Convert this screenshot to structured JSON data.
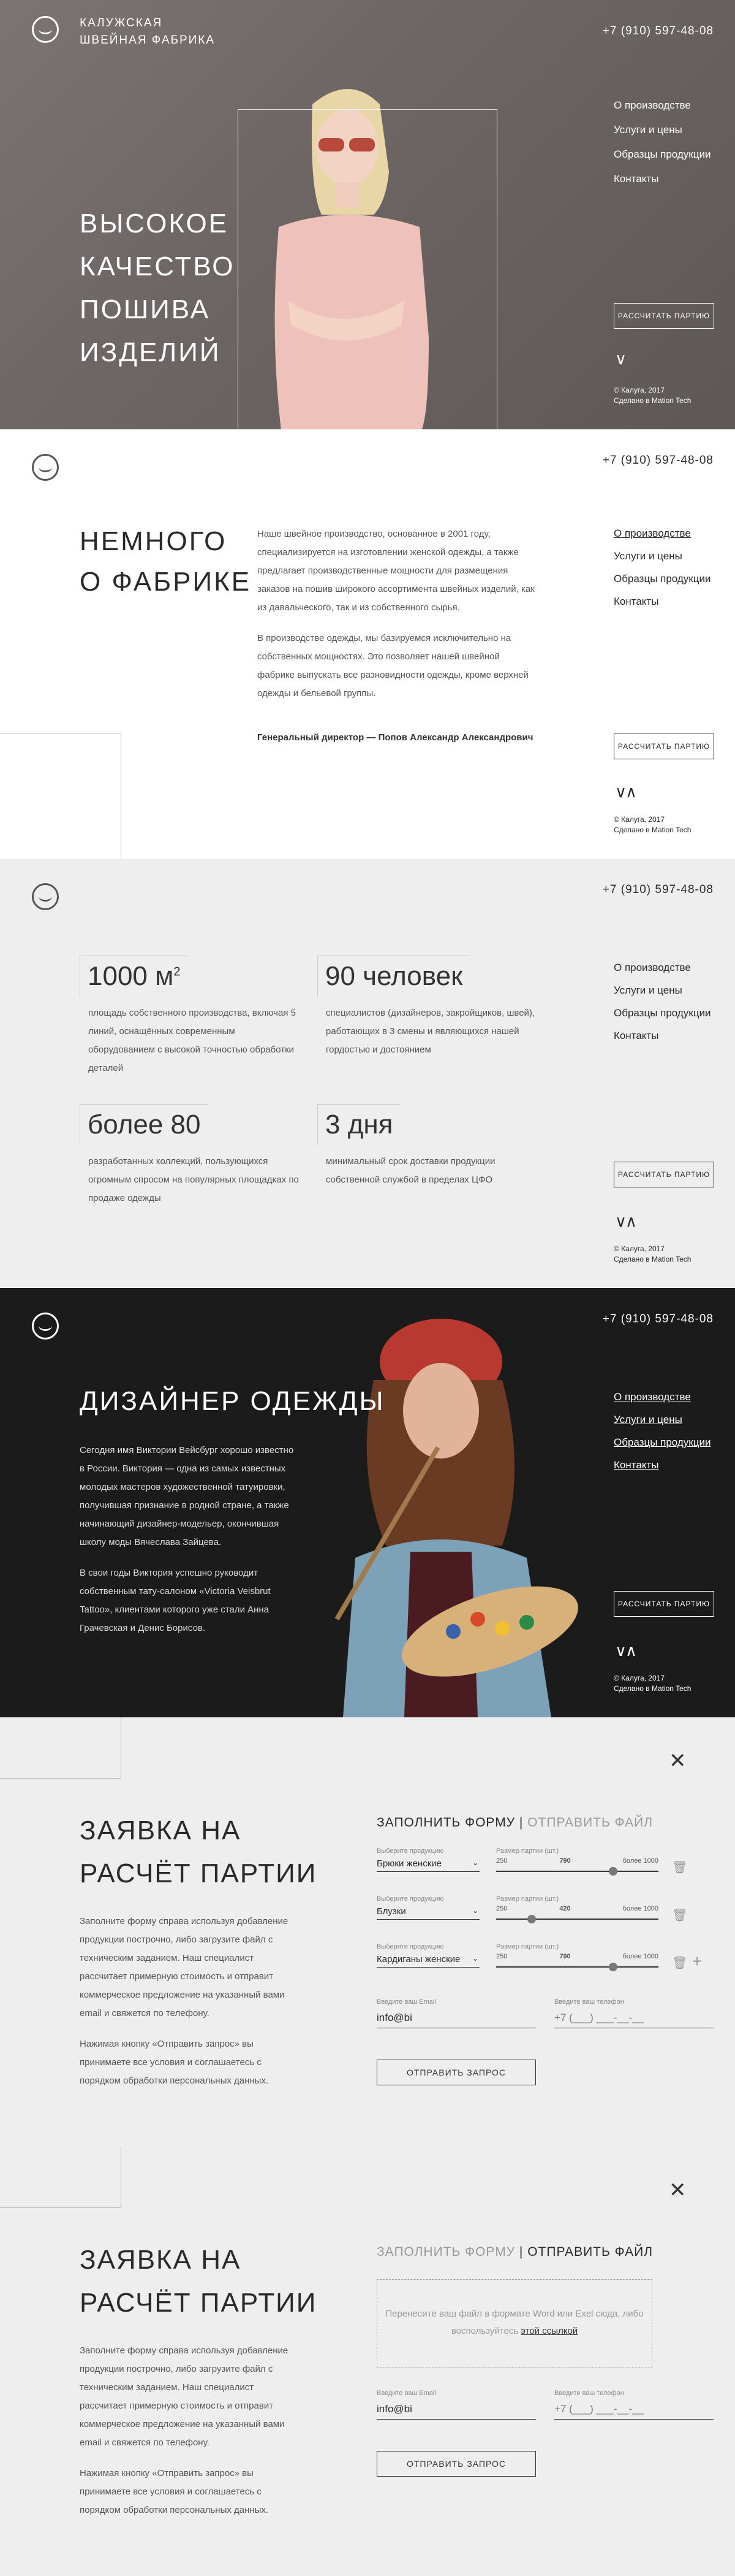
{
  "brand": {
    "line1": "КАЛУЖСКАЯ",
    "line2": "ШВЕЙНАЯ ФАБРИКА"
  },
  "phone": "+7 (910) 597-48-08",
  "nav": [
    "О производстве",
    "Услуги и цены",
    "Образцы продукции",
    "Контакты"
  ],
  "calc_button": "РАССЧИТАТЬ ПАРТИЮ",
  "copyright": {
    "line1": "© Калуга, 2017",
    "line2": "Сделано в Mation Tech"
  },
  "hero": {
    "title": [
      "ВЫСОКОЕ",
      "КАЧЕСТВО",
      "ПОШИВА",
      "ИЗДЕЛИЙ"
    ]
  },
  "about": {
    "title": [
      "НЕМНОГО",
      "О ФАБРИКЕ"
    ],
    "p1": "Наше швейное производство, основанное в 2001 году, специализируется на изготовлении женской одежды, а также предлагает производственные мощности для размещения заказов на пошив широкого ассортимента швейных изделий, как из давальческого, так и из собственного сырья.",
    "p2": "В производстве одежды, мы базируемся исключительно на собственных мощностях. Это позволяет нашей швейной фабрике выпускать все разновидности одежды, кроме верхней одежды и бельевой группы.",
    "sign": "Генеральный директор — Попов Александр Александрович"
  },
  "stats": [
    {
      "num": "1000 м",
      "sup": "2",
      "desc": "площадь собственного производства, включая 5 линий, оснащённых современным оборудованием с высокой точностью обработки деталей"
    },
    {
      "num": "90 человек",
      "sup": "",
      "desc": "специалистов (дизайнеров, закройщиков, швей), работающих в 3 смены и являющихся нашей гордостью и достоянием"
    },
    {
      "num": "более 80",
      "sup": "",
      "desc": "разработанных коллекций, пользующихся огромным спросом на популярных площадках по продаже одежды"
    },
    {
      "num": "3 дня",
      "sup": "",
      "desc": "минимальный срок доставки продукции собственной службой в пределах ЦФО"
    }
  ],
  "designer": {
    "title": "ДИЗАЙНЕР ОДЕЖДЫ",
    "p1": "Сегодня имя Виктории Вейсбург хорошо известно в России. Виктория — одна из самых известных молодых мастеров художественной татуировки, получившая признание в родной стране, а также начинающий дизайнер-модельер, окончившая школу моды Вячеслава Зайцева.",
    "p2": "В свои годы Виктория успешно руководит собственным тату-салоном «Victoria Veisbrut Tattoo», клиентами которого уже стали Анна Грачевская и Денис Борисов."
  },
  "form": {
    "title": [
      "ЗАЯВКА НА",
      "РАСЧЁТ ПАРТИИ"
    ],
    "p1": "Заполните форму справа используя добавление продукции построчно, либо загрузите файл с техническим заданием. Наш специалист рассчитает примерную стоимость и отправит коммерческое предложение на указанный вами email и свяжется по телефону.",
    "p2": "Нажимая кнопку «Отправить запрос» вы принимаете все условия и соглашаетесь с порядком обработки персональных данных.",
    "tab_fill": "ЗАПОЛНИТЬ ФОРМУ",
    "tab_sep": "|",
    "tab_file": "ОТПРАВИТЬ ФАЙЛ",
    "product_label": "Выберите продукцию",
    "qty_label": "Размер партии (шт.)",
    "rows": [
      {
        "product": "Брюки женские",
        "min": "250",
        "val": "790",
        "max": "более 1000",
        "fill": 0.72
      },
      {
        "product": "Блузки",
        "min": "250",
        "val": "420",
        "max": "более 1000",
        "fill": 0.22
      },
      {
        "product": "Кардиганы женские",
        "min": "250",
        "val": "790",
        "max": "более 1000",
        "fill": 0.72
      }
    ],
    "email_label": "Введите ваш Email",
    "email_value": "info@bi",
    "phone_label": "Введите ваш телефон",
    "phone_value": "+7 (___) ___-__-__",
    "send_button": "ОТПРАВИТЬ ЗАПРОС",
    "drop_text": "Перенесите ваш файл в формате Word или Exel сюда, либо воспользуйтесь",
    "drop_link": "этой ссылкой"
  },
  "icons": {
    "logo": "logo-icon",
    "close": "close-icon",
    "trash": "trash-icon",
    "plus": "plus-icon",
    "chevron": "chevron-down-icon"
  }
}
